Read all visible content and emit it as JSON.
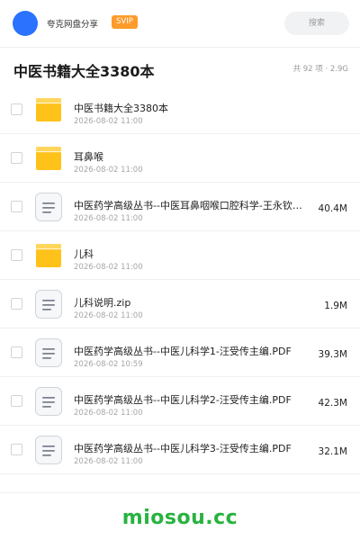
{
  "header": {
    "brand": "夸克网盘分享",
    "badge": "SVIP",
    "search_placeholder": "搜索"
  },
  "folder": {
    "title": "中医书籍大全3380本",
    "summary": "共 92 项 · 2.9G"
  },
  "files": [
    {
      "type": "folder",
      "name": "中医书籍大全3380本",
      "date": "2026-08-02 11:00",
      "size": ""
    },
    {
      "type": "folder",
      "name": "耳鼻喉",
      "date": "2026-08-02 11:00",
      "size": ""
    },
    {
      "type": "file",
      "name": "中医药学高级丛书--中医耳鼻咽喉口腔科学-王永钦主…",
      "date": "2026-08-02 11:00",
      "size": "40.4M"
    },
    {
      "type": "folder",
      "name": "儿科",
      "date": "2026-08-02 11:00",
      "size": ""
    },
    {
      "type": "file",
      "name": "儿科说明.zip",
      "date": "2026-08-02 11:00",
      "size": "1.9M"
    },
    {
      "type": "file",
      "name": "中医药学高级丛书--中医儿科学1-汪受传主编.PDF",
      "date": "2026-08-02 10:59",
      "size": "39.3M"
    },
    {
      "type": "file",
      "name": "中医药学高级丛书--中医儿科学2-汪受传主编.PDF",
      "date": "2026-08-02 11:00",
      "size": "42.3M"
    },
    {
      "type": "file",
      "name": "中医药学高级丛书--中医儿科学3-汪受传主编.PDF",
      "date": "2026-08-02 11:00",
      "size": "32.1M"
    }
  ],
  "watermark": "miosou.cc",
  "colors": {
    "accent": "#2b72ff",
    "badge": "#ff9b2a",
    "folder": "#ffc21a",
    "watermark": "#27b33f"
  }
}
